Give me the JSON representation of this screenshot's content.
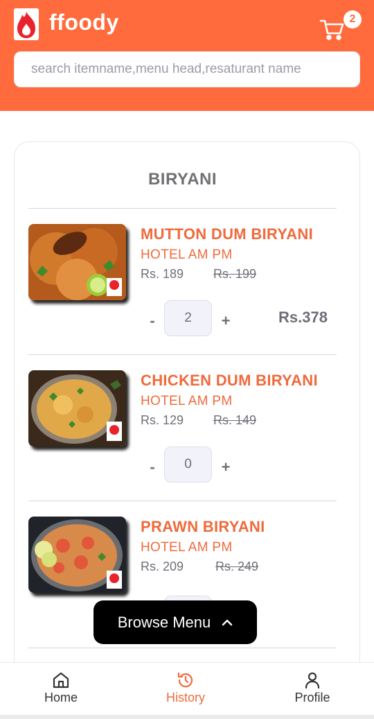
{
  "app": {
    "brand": "ffoody",
    "cart_count": "2",
    "accent_color": "#ff6b3d",
    "icons": {
      "logo": "flame-logo-icon",
      "cart": "cart-icon"
    }
  },
  "search": {
    "placeholder": "search itemname,menu head,resaturant name",
    "value": ""
  },
  "menu": {
    "section_title": "BIRYANI",
    "items": [
      {
        "name": "MUTTON DUM BIRYANI",
        "hotel": "HOTEL AM PM",
        "price": "Rs. 189",
        "mrp": "Rs. 199",
        "quantity": "2",
        "total": "Rs.378"
      },
      {
        "name": "CHICKEN DUM BIRYANI",
        "hotel": "HOTEL AM PM",
        "price": "Rs. 129",
        "mrp": "Rs. 149",
        "quantity": "0",
        "total": ""
      },
      {
        "name": "PRAWN BIRYANI",
        "hotel": "HOTEL AM PM",
        "price": "Rs. 209",
        "mrp": "Rs. 249",
        "quantity": "",
        "total": ""
      }
    ],
    "minus_label": "-",
    "plus_label": "+"
  },
  "browse_menu": {
    "label": "Browse Menu",
    "icon": "chevron-up-icon"
  },
  "bottom_nav": {
    "items": [
      {
        "label": "Home",
        "icon": "home-icon",
        "active": false
      },
      {
        "label": "History",
        "icon": "history-icon",
        "active": true
      },
      {
        "label": "Profile",
        "icon": "profile-icon",
        "active": false
      }
    ]
  }
}
